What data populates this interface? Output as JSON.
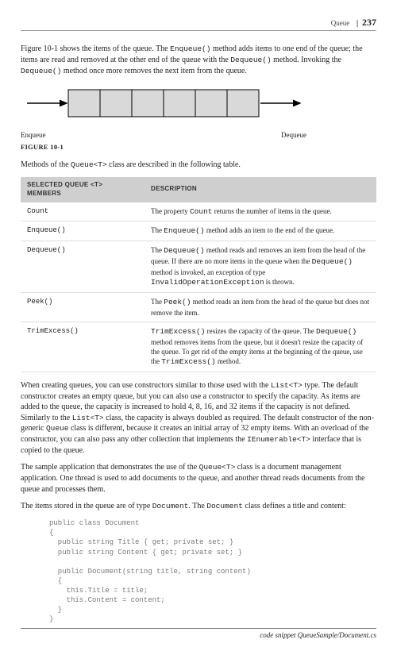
{
  "header": {
    "section": "Queue",
    "page": "237"
  },
  "para1_a": "Figure 10-1 shows the items of the queue. The ",
  "para1_b": " method adds items to one end of the queue; the items are read and removed at the other end of the queue with the ",
  "para1_c": " method. Invoking the ",
  "para1_d": " method once more removes the next item from the queue.",
  "code_enqueue": "Enqueue()",
  "code_dequeue": "Dequeue()",
  "fig": {
    "enqueue": "Enqueue",
    "dequeue": "Dequeue",
    "caption": "FIGURE 10-1"
  },
  "para2_a": "Methods of the ",
  "para2_b": " class are described in the following table.",
  "code_queueT": "Queue<T>",
  "table": {
    "head": {
      "member": "SELECTED QUEUE <T> MEMBERS",
      "desc": "DESCRIPTION"
    },
    "rows": [
      {
        "member": "Count",
        "desc_a": "The property ",
        "desc_code1": "Count",
        "desc_b": " returns the number of items in the queue."
      },
      {
        "member": "Enqueue()",
        "desc_a": "The ",
        "desc_code1": "Enqueue()",
        "desc_b": " method adds an item to the end of the queue."
      },
      {
        "member": "Dequeue()",
        "desc_a": "The ",
        "desc_code1": "Dequeue()",
        "desc_b": " method reads and removes an item from the head of the queue. If there are no more items in the queue when the ",
        "desc_code2": "Dequeue()",
        "desc_c": " method is invoked, an exception of type ",
        "desc_code3": "InvalidOperationException",
        "desc_d": " is thrown."
      },
      {
        "member": "Peek()",
        "desc_a": "The ",
        "desc_code1": "Peek()",
        "desc_b": " method reads an item from the head of the queue but does not remove the item."
      },
      {
        "member": "TrimExcess()",
        "desc_a": "",
        "desc_code1": "TrimExcess()",
        "desc_b": " resizes the capacity of the queue. The ",
        "desc_code2": "Dequeue()",
        "desc_c": " method removes items from the queue, but it doesn't resize the capacity of the queue. To get rid of the empty items at the beginning of the queue, use the ",
        "desc_code3": "TrimExcess()",
        "desc_d": " method."
      }
    ]
  },
  "para3": {
    "a": "When creating queues, you can use constructors similar to those used with the ",
    "c1": "List<T>",
    "b": " type. The default constructor creates an empty queue, but you can also use a constructor to specify the capacity. As items are added to the queue, the capacity is increased to hold 4, 8, 16, and 32 items if the capacity is not defined. Similarly to the ",
    "c2": "List<T>",
    "c": " class, the capacity is always doubled as required. The default constructor of the non-generic ",
    "c3": "Queue",
    "d": " class is different, because it creates an initial array of 32 empty items. With an overload of the constructor, you can also pass any other collection that implements the ",
    "c4": "IEnumerable<T>",
    "e": " interface that is copied to the queue."
  },
  "para4": {
    "a": "The sample application that demonstrates the use of the ",
    "c1": "Queue<T>",
    "b": " class is a document management application. One thread is used to add documents to the queue, and another thread reads documents from the queue and processes them."
  },
  "para5": {
    "a": "The items stored in the queue are of type ",
    "c1": "Document",
    "b": ". The ",
    "c2": "Document",
    "c": " class defines a title and content:"
  },
  "code": "public class Document\n{\n  public string Title { get; private set; }\n  public string Content { get; private set; }\n\n  public Document(string title, string content)\n  {\n    this.Title = title;\n    this.Content = content;\n  }\n}",
  "snippet": "code snippet QueueSample/Document.cs"
}
